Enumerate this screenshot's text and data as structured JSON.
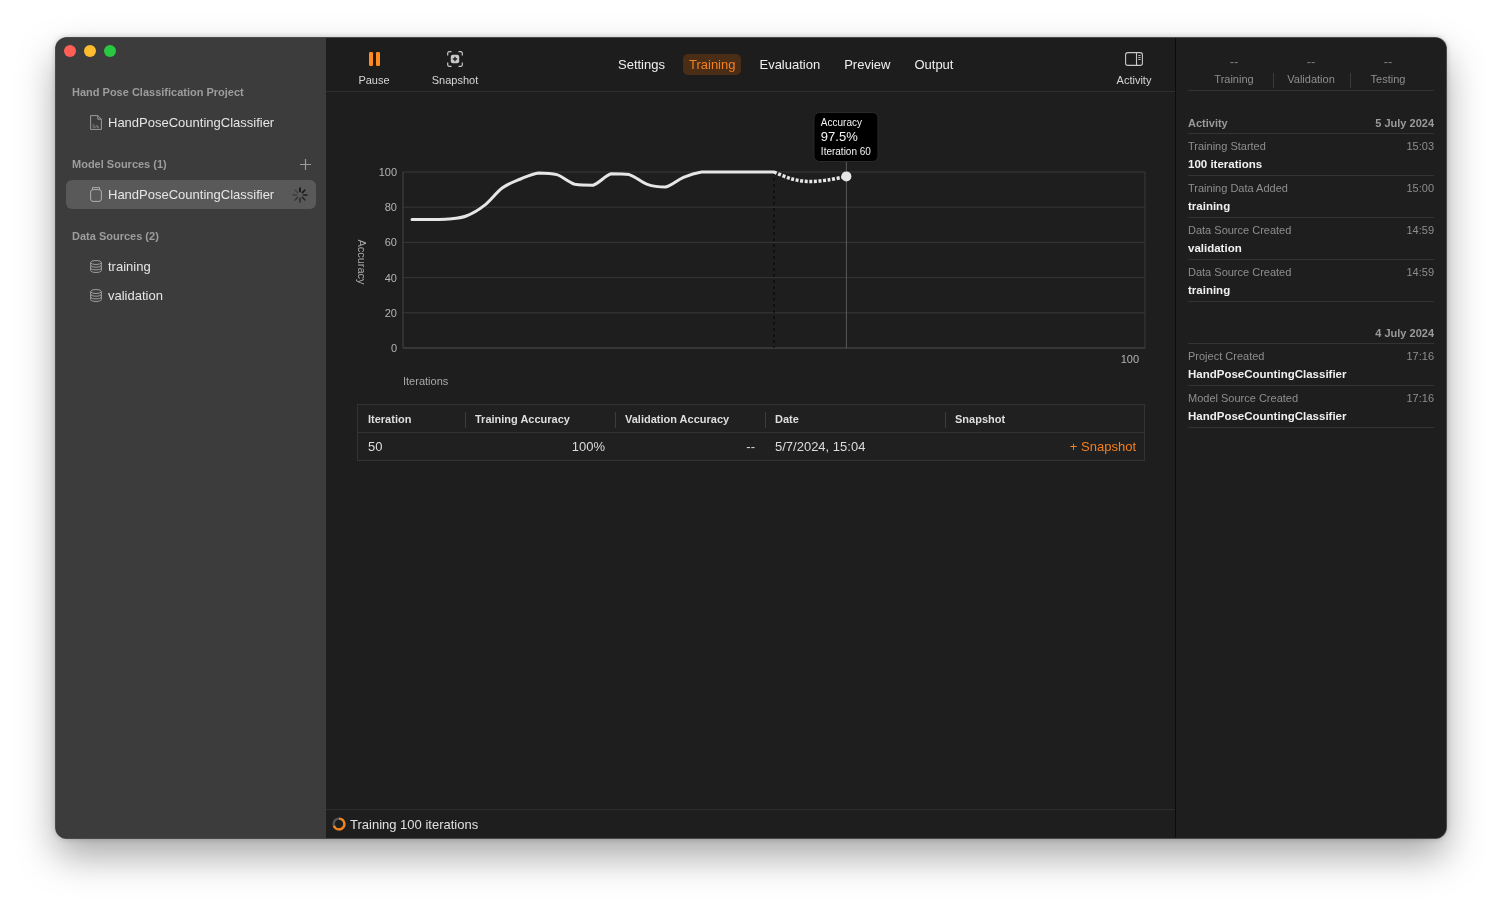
{
  "window": {
    "traffic_lights": [
      {
        "kind": "close"
      },
      {
        "kind": "minimize"
      },
      {
        "kind": "zoom"
      }
    ]
  },
  "sidebar": {
    "sections": [
      {
        "title": "Hand Pose Classification Project",
        "add_button": false,
        "items": [
          {
            "kind": "model-file",
            "label": "HandPoseCountingClassifier",
            "selected": false,
            "busy": false
          }
        ]
      },
      {
        "title": "Model Sources (1)",
        "add_button": true,
        "items": [
          {
            "kind": "model-source",
            "label": "HandPoseCountingClassifier",
            "selected": true,
            "busy": true
          }
        ]
      },
      {
        "title": "Data Sources (2)",
        "add_button": false,
        "items": [
          {
            "kind": "data-source",
            "label": "training",
            "selected": false,
            "busy": false
          },
          {
            "kind": "data-source",
            "label": "validation",
            "selected": false,
            "busy": false
          }
        ]
      }
    ]
  },
  "toolbar": {
    "actions_left": [
      {
        "kind": "pause",
        "label": "Pause"
      },
      {
        "kind": "snapshot",
        "label": "Snapshot"
      }
    ],
    "tabs": [
      {
        "label": "Settings",
        "selected": false
      },
      {
        "label": "Training",
        "selected": true
      },
      {
        "label": "Evaluation",
        "selected": false
      },
      {
        "label": "Preview",
        "selected": false
      },
      {
        "label": "Output",
        "selected": false
      }
    ],
    "actions_right": [
      {
        "kind": "inspector",
        "label": "Activity"
      }
    ]
  },
  "chart": {
    "tooltip": {
      "title": "Accuracy",
      "value": "97.5%",
      "label": "Iteration 60"
    },
    "chart_data": {
      "type": "line",
      "xlabel": "Iterations",
      "ylabel": "Accuracy",
      "series": [
        {
          "color": "#e6e6e6",
          "line_style": "solid",
          "values": [
            73,
            73,
            73.3,
            75,
            81,
            91,
            96,
            99.5,
            98.5,
            93,
            92.5,
            99,
            98.5,
            93,
            91.5,
            97,
            100,
            100,
            100,
            100,
            100,
            null,
            null,
            null,
            null,
            null,
            null,
            null,
            null,
            null,
            null,
            null,
            null,
            null,
            null,
            null,
            null,
            null,
            null,
            null,
            null
          ]
        },
        {
          "color": "#e6e6e6",
          "line_style": "dashed",
          "values": [
            null,
            null,
            null,
            null,
            null,
            null,
            null,
            null,
            null,
            null,
            null,
            null,
            null,
            null,
            null,
            null,
            null,
            null,
            null,
            null,
            100,
            96,
            94.6,
            95.5,
            97.5,
            null,
            null,
            null,
            null,
            null,
            null,
            null,
            null,
            null,
            null,
            null,
            null,
            null,
            null,
            null,
            null
          ]
        }
      ],
      "ylim": [
        0,
        100
      ],
      "yticks": [
        0,
        20,
        40,
        60,
        80,
        100
      ],
      "grid": true,
      "annotations": [
        "100"
      ]
    }
  },
  "table": {
    "columns": [
      "Iteration",
      "Training Accuracy",
      "Validation Accuracy",
      "Date",
      "Snapshot"
    ],
    "rows": [
      {
        "cells": [
          "50",
          "100%",
          "--",
          "5/7/2024, 15:04"
        ],
        "action": "+ Snapshot"
      }
    ]
  },
  "status_bar": {
    "busy": true,
    "text": "Training 100 iterations"
  },
  "inspector": {
    "metrics": [
      {
        "value": "--",
        "label": "Training"
      },
      {
        "value": "--",
        "label": "Validation"
      },
      {
        "value": "--",
        "label": "Testing"
      }
    ],
    "groups": [
      {
        "title": "Activity",
        "date": "5 July 2024",
        "entries": [
          {
            "event": "Training Started",
            "time": "15:03",
            "detail": "100 iterations"
          },
          {
            "event": "Training Data Added",
            "time": "15:00",
            "detail": "training"
          },
          {
            "event": "Data Source Created",
            "time": "14:59",
            "detail": "validation"
          },
          {
            "event": "Data Source Created",
            "time": "14:59",
            "detail": "training"
          }
        ]
      },
      {
        "date": "4 July 2024",
        "entries": [
          {
            "event": "Project Created",
            "time": "17:16",
            "detail": "HandPoseCountingClassifier"
          },
          {
            "event": "Model Source Created",
            "time": "17:16",
            "detail": "HandPoseCountingClassifier"
          }
        ]
      }
    ]
  }
}
